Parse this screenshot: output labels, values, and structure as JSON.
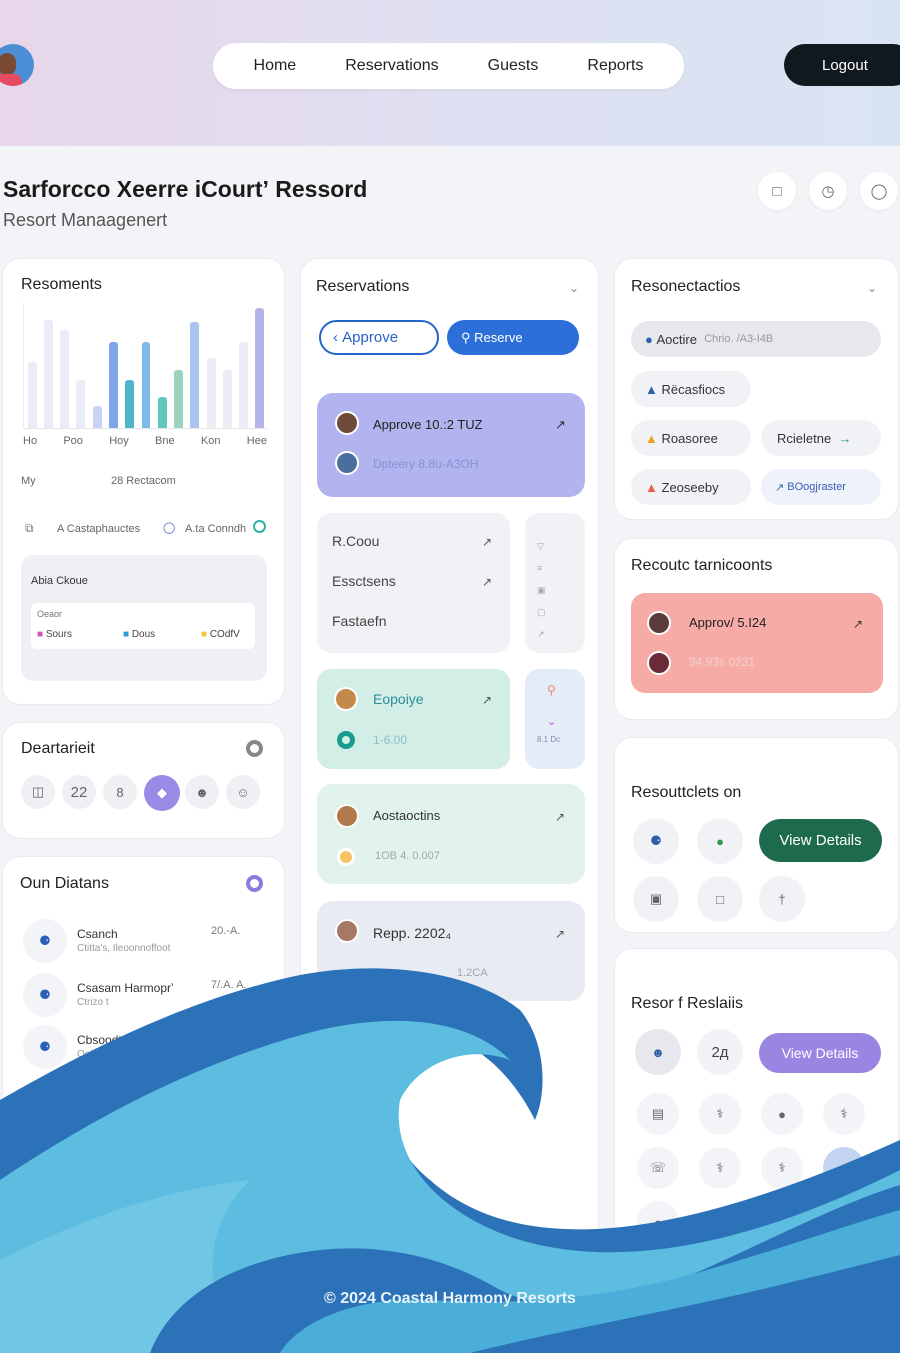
{
  "nav": {
    "items": [
      "Home",
      "Reservations",
      "Guests",
      "Reports"
    ],
    "logout": "Logout"
  },
  "header": {
    "title": "Sarforcco Xeerre iCourtʼ Ressord",
    "subtitle": "Resort Manaagenert"
  },
  "card1": {
    "title": "Resoments",
    "chart_data": {
      "type": "bar",
      "categories": [
        "Ho",
        "Poo",
        "Hoy",
        "Bne",
        "Kon",
        "Hee"
      ],
      "series": [
        {
          "values": [
            55,
            90,
            82,
            40,
            18,
            72,
            40,
            72,
            26,
            48,
            88,
            58,
            48,
            72,
            100
          ]
        }
      ],
      "colors": [
        "#e9ecf6",
        "#e9ecf6",
        "#e9ecf6",
        "#e9ecf6",
        "#c9d3f6",
        "#7fa6e8",
        "#4fb5c8",
        "#7fb9ea",
        "#5fc7bd",
        "#9ad4c0",
        "#a8c4ef",
        "#ecedf5",
        "#ecedf5",
        "#ecedf5",
        "#b4b3ea"
      ]
    },
    "row_label": "My",
    "row_value": "28 Rectacom",
    "legend": [
      "A Castaphauctes",
      "A.ta Conndh"
    ],
    "inner_title": "Abia Ckoue",
    "inner_sub": "Oeaor",
    "tags": [
      "Sours",
      "Dous",
      "COdfV"
    ]
  },
  "card2": {
    "title": "Deartarieit",
    "items": [
      "22",
      "8"
    ]
  },
  "card3": {
    "title": "Oun Diatans",
    "rows": [
      {
        "name": "Csanch",
        "sub": "Ctitta's, Ileoonnoffoot",
        "val": "20.-A."
      },
      {
        "name": "Csasam Harmoprʼ",
        "sub": "Ctrizo t",
        "val": "7/.A. A."
      },
      {
        "name": "Cbsoodts",
        "sub": "Ooina"
      }
    ]
  },
  "card4": {
    "title": "Reservations",
    "approve": "Approve",
    "reserve": "Reserve",
    "hero": {
      "line1": "Approve 10.:2 TUZ",
      "line2": "Dpteery 8.8u-A3OH"
    },
    "list": [
      "R.Coou",
      "Essctsens",
      "Fastaefn"
    ],
    "teal": {
      "title": "Eopoiye",
      "val": "1-6.00",
      "side": "8.1 Dc"
    },
    "mint": {
      "title": "Aostaoctins",
      "val": "1OB 4. 0.007"
    },
    "report": {
      "title": "Repp. 2202₄",
      "val": "1.2CA"
    }
  },
  "card5": {
    "title": "Resonectactios",
    "chip1": "Aoctire",
    "chip1b": "Chrio.  /A3-I4B",
    "chips": [
      "Rëcasfiocs",
      "Roasoree",
      "Rcieletne",
      "Zeoseeby",
      "BOogjraster"
    ]
  },
  "card6": {
    "title": "Recoutc tarnicoonts",
    "line1": "Approv/ 5.I24",
    "line2": "34.93s 0231"
  },
  "card7": {
    "title": "Resouttclets on",
    "button": "View Details"
  },
  "card8": {
    "title": "Resor f Reslaiis",
    "val": "2д",
    "button": "View Details"
  },
  "footer": {
    "text": "© 2024 Coastal Harmony Resorts"
  }
}
